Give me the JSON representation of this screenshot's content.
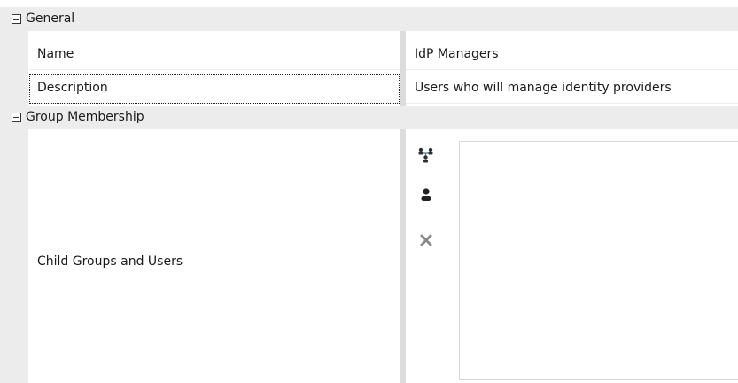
{
  "categories": {
    "general": {
      "label": "General"
    },
    "group_membership": {
      "label": "Group Membership"
    }
  },
  "properties": {
    "name": {
      "label": "Name",
      "value": "IdP Managers"
    },
    "description": {
      "label": "Description",
      "value": "Users who will manage identity providers"
    },
    "child_groups_users": {
      "label": "Child Groups and Users",
      "items": []
    }
  },
  "icons": {
    "add_group": "add-group-icon",
    "add_user": "add-user-icon",
    "remove": "remove-icon"
  }
}
